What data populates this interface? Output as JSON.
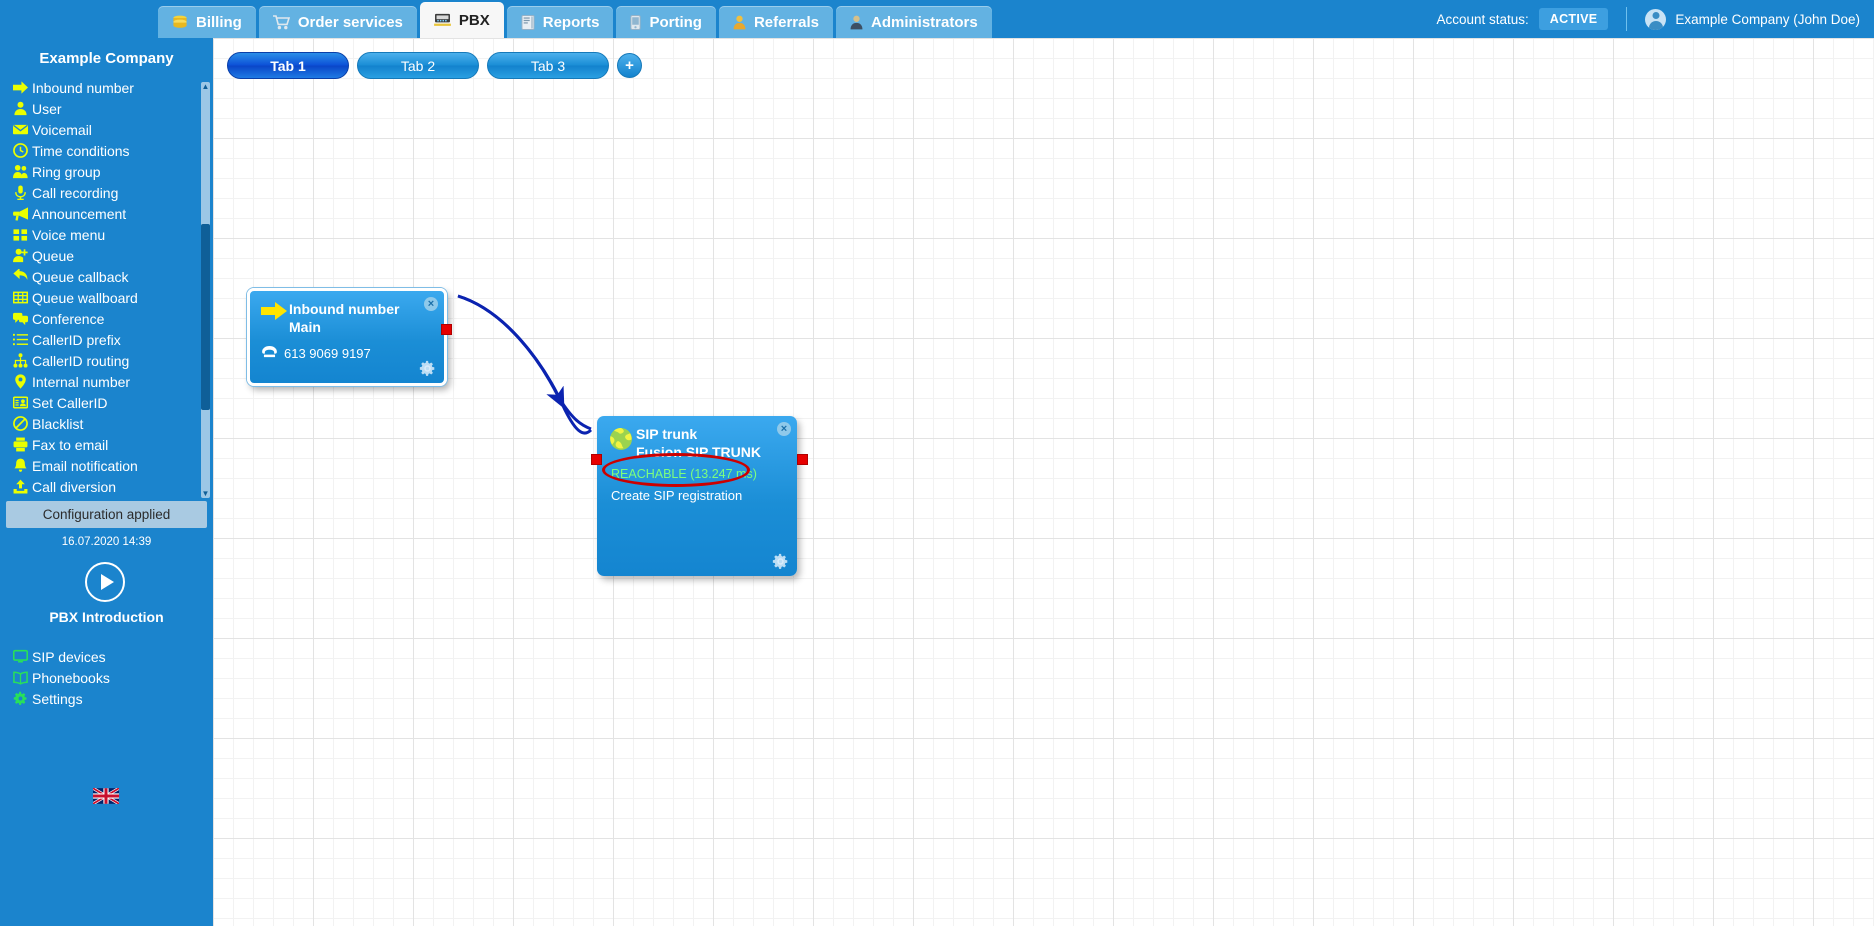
{
  "topbar": {
    "nav_items": [
      {
        "label": "Billing",
        "icon": "coins-icon",
        "active": false
      },
      {
        "label": "Order services",
        "icon": "shopping-cart-icon",
        "active": false
      },
      {
        "label": "PBX",
        "icon": "pbx-switchboard-icon",
        "active": true
      },
      {
        "label": "Reports",
        "icon": "report-book-icon",
        "active": false
      },
      {
        "label": "Porting",
        "icon": "mobile-phone-icon",
        "active": false
      },
      {
        "label": "Referrals",
        "icon": "person-yellow-icon",
        "active": false
      },
      {
        "label": "Administrators",
        "icon": "person-dark-icon",
        "active": false
      }
    ],
    "account_status_label": "Account status:",
    "account_status_value": "ACTIVE",
    "user_name": "Example Company (John Doe)",
    "avatar_icon": "user-avatar-icon"
  },
  "sidebar": {
    "company": "Example Company",
    "items": [
      {
        "label": "Inbound number",
        "icon": "arrow-right-icon"
      },
      {
        "label": "User",
        "icon": "person-icon"
      },
      {
        "label": "Voicemail",
        "icon": "envelope-icon"
      },
      {
        "label": "Time conditions",
        "icon": "clock-icon"
      },
      {
        "label": "Ring group",
        "icon": "people-group-icon"
      },
      {
        "label": "Call recording",
        "icon": "microphone-icon"
      },
      {
        "label": "Announcement",
        "icon": "megaphone-icon"
      },
      {
        "label": "Voice menu",
        "icon": "grid-squares-icon"
      },
      {
        "label": "Queue",
        "icon": "person-plus-icon"
      },
      {
        "label": "Queue callback",
        "icon": "arrow-undo-icon"
      },
      {
        "label": "Queue wallboard",
        "icon": "table-grid-icon"
      },
      {
        "label": "Conference",
        "icon": "chat-bubbles-icon"
      },
      {
        "label": "CallerID prefix",
        "icon": "list-icon"
      },
      {
        "label": "CallerID routing",
        "icon": "sitemap-icon"
      },
      {
        "label": "Internal number",
        "icon": "map-pin-icon"
      },
      {
        "label": "Set CallerID",
        "icon": "id-card-icon"
      },
      {
        "label": "Blacklist",
        "icon": "no-entry-icon"
      },
      {
        "label": "Fax to email",
        "icon": "fax-printer-icon"
      },
      {
        "label": "Email notification",
        "icon": "bell-icon"
      },
      {
        "label": "Call diversion",
        "icon": "upload-arrow-icon"
      }
    ],
    "config_banner": "Configuration applied",
    "config_time": "16.07.2020 14:39",
    "intro_label": "PBX Introduction",
    "intro_icon": "play-circle-icon",
    "bottom_items": [
      {
        "label": "SIP devices",
        "icon": "monitor-icon"
      },
      {
        "label": "Phonebooks",
        "icon": "open-book-icon"
      },
      {
        "label": "Settings",
        "icon": "gear-icon"
      }
    ],
    "language_flag": "uk-flag-icon",
    "scrollbar_up_icon": "caret-up-icon",
    "scrollbar_down_icon": "caret-down-icon"
  },
  "canvas": {
    "tabs": [
      {
        "label": "Tab 1",
        "active": true
      },
      {
        "label": "Tab 2",
        "active": false
      },
      {
        "label": "Tab 3",
        "active": false
      }
    ],
    "add_tab_label": "+",
    "nodes": {
      "inbound": {
        "title": "Inbound number",
        "subtitle": "Main",
        "phone_icon": "telephone-icon",
        "phone_number": "613 9069 9197",
        "type_icon": "arrow-right-icon",
        "close_icon": "close-icon",
        "gear_icon": "gear-icon"
      },
      "siptrunk": {
        "title": "SIP trunk",
        "subtitle": "Fusion SIP TRUNK",
        "status": "REACHABLE (13.247 ms)",
        "action": "Create SIP registration",
        "type_icon": "globe-network-icon",
        "close_icon": "close-icon",
        "gear_icon": "gear-icon"
      }
    },
    "connection": {
      "name": "inbound-to-siptrunk-link",
      "arrow_color": "#0b23b0",
      "port_color": "#e60000"
    },
    "annotation": {
      "name": "red-ellipse-highlight",
      "color": "#cc0000"
    }
  }
}
